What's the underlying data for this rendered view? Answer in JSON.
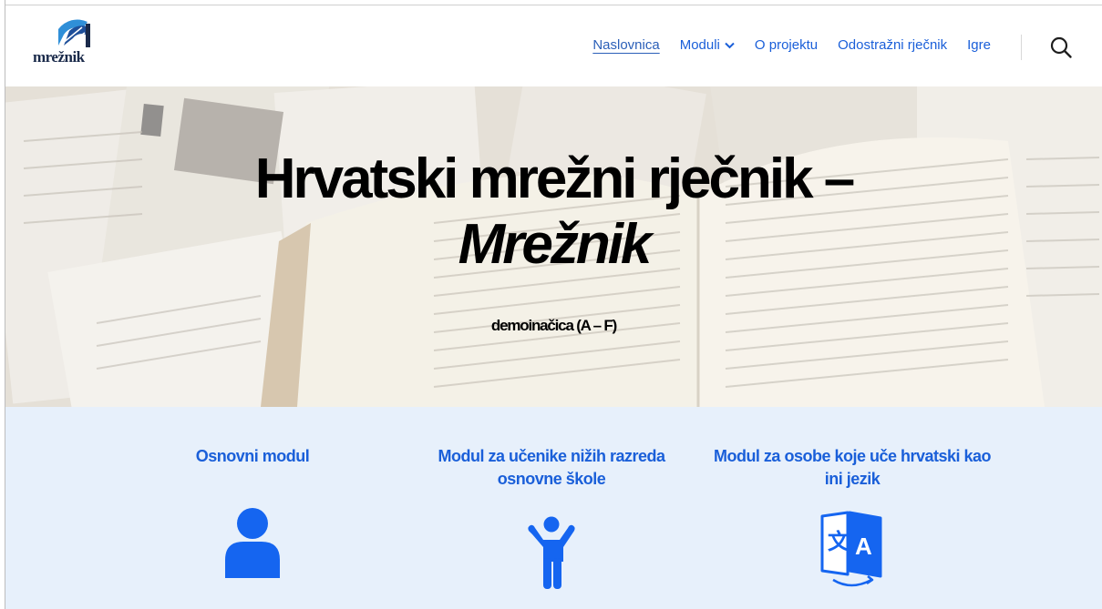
{
  "header": {
    "logo_text": "mrežnik",
    "nav": [
      {
        "label": "Naslovnica",
        "active": true
      },
      {
        "label": "Moduli",
        "has_dropdown": true
      },
      {
        "label": "O projektu"
      },
      {
        "label": "Odostražni rječnik"
      },
      {
        "label": "Igre"
      }
    ],
    "search_icon": "search-icon"
  },
  "hero": {
    "title_line1": "Hrvatski mrežni rječnik –",
    "title_line2": "Mrežnik",
    "subtitle": "demoinačica (A – F)"
  },
  "modules": [
    {
      "title": "Osnovni modul",
      "icon": "person-icon"
    },
    {
      "title": "Modul za učenike nižih razreda osnovne škole",
      "icon": "child-icon"
    },
    {
      "title": "Modul za osobe koje uče hrvatski kao ini jezik",
      "icon": "translate-icon"
    }
  ],
  "colors": {
    "accent": "#1a5fd9",
    "icon_blue": "#1565f0",
    "modules_bg": "#e7f0fb"
  }
}
